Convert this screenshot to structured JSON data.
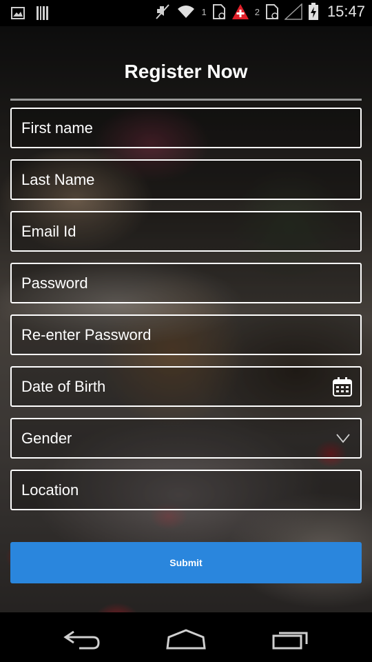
{
  "status_bar": {
    "time": "15:47",
    "sim1": "1",
    "sim2": "2",
    "icons": [
      "image-icon",
      "barcode-icon",
      "mute-icon",
      "wifi-icon",
      "sim1-icon",
      "alert-icon",
      "sim2-icon",
      "signal-icon",
      "battery-icon"
    ]
  },
  "form": {
    "title": "Register Now",
    "fields": [
      {
        "placeholder": "First name"
      },
      {
        "placeholder": "Last Name"
      },
      {
        "placeholder": "Email Id"
      },
      {
        "placeholder": "Password"
      },
      {
        "placeholder": "Re-enter Password"
      },
      {
        "placeholder": "Date of Birth"
      },
      {
        "placeholder": "Gender"
      },
      {
        "placeholder": "Location"
      }
    ],
    "submit_label": "Submit"
  },
  "nav_bar": {
    "icons": [
      "back-icon",
      "home-icon",
      "recents-icon"
    ]
  },
  "colors": {
    "accent": "#2a86dd",
    "field_border": "#ffffff",
    "divider": "#9a9a9a"
  }
}
